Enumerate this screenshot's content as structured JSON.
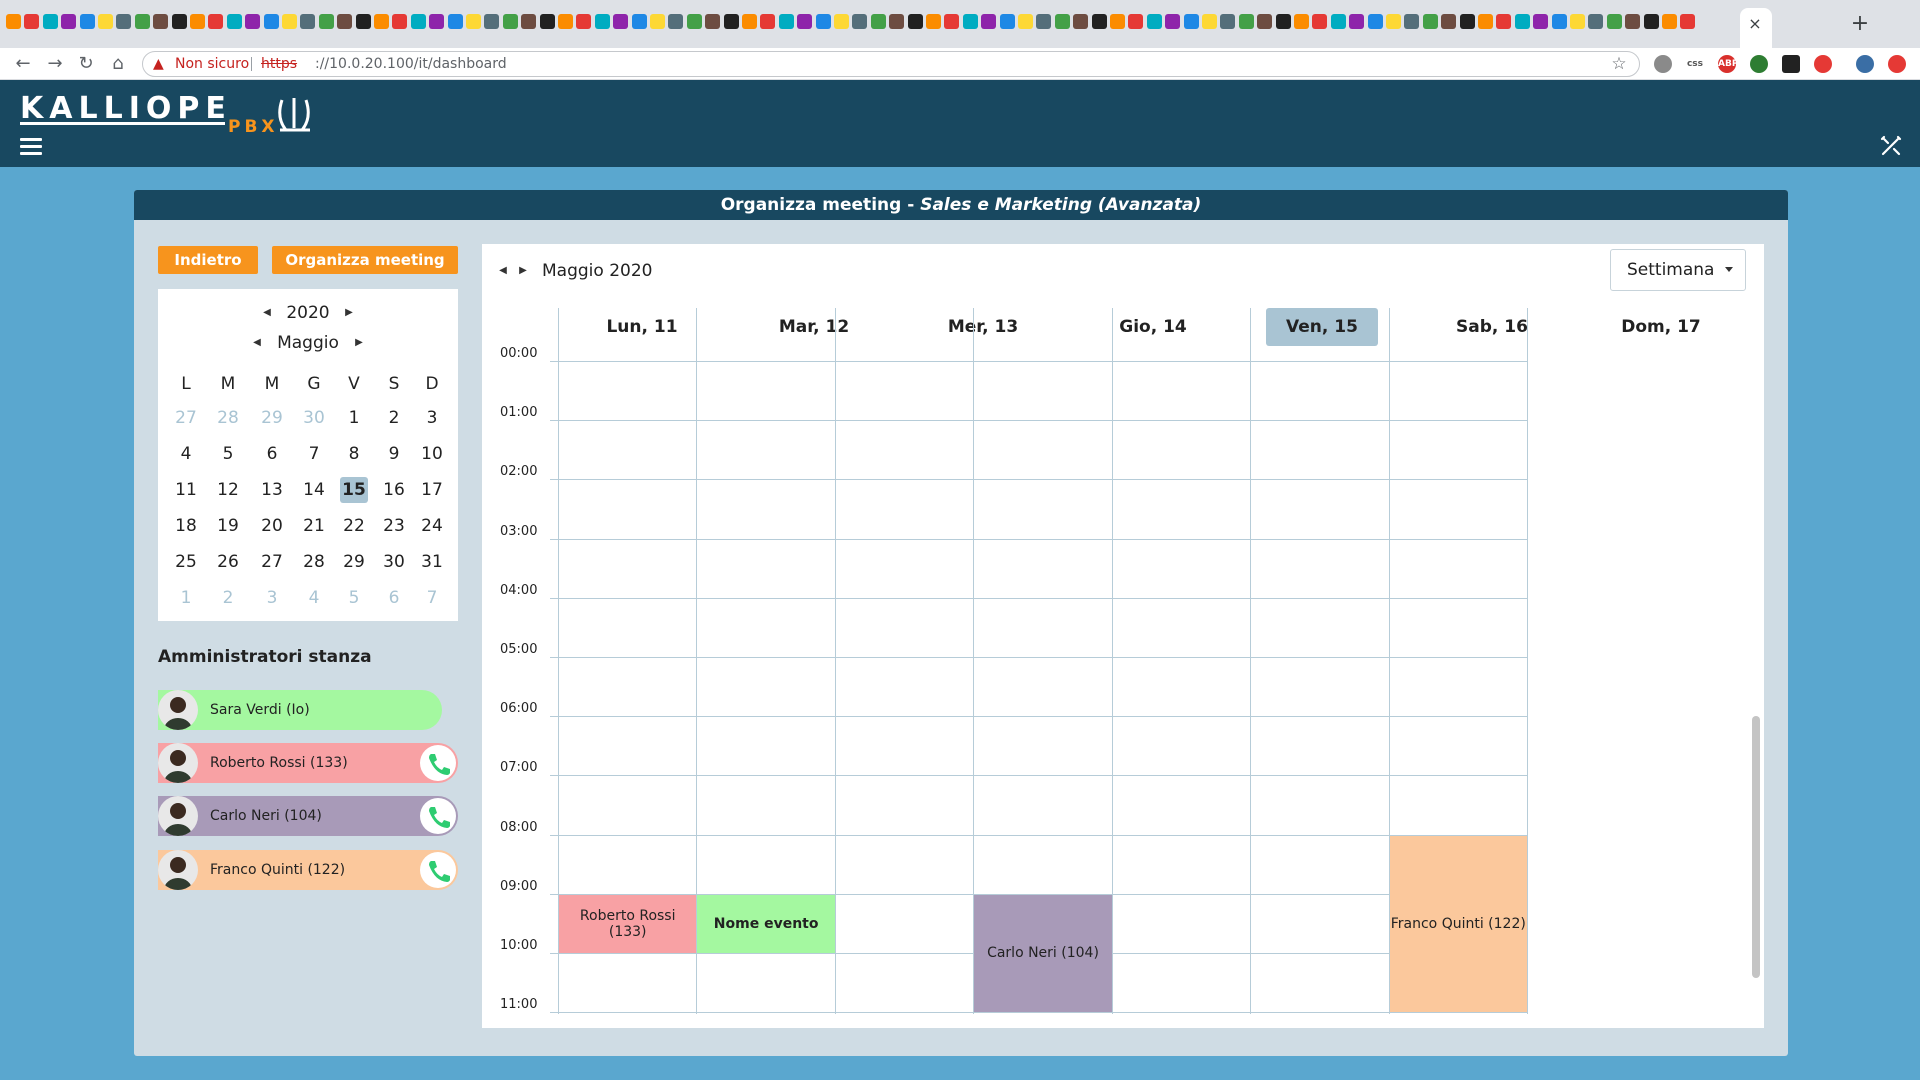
{
  "browser": {
    "not_secure": "Non sicuro",
    "url_scheme": "https",
    "url_rest": "://10.0.20.100/it/dashboard",
    "tab_close": "×",
    "new_tab": "+"
  },
  "app": {
    "logo_text": "KALLIOPE",
    "logo_sub": "PBX"
  },
  "panel": {
    "title": "Organizza meeting",
    "title_sep": " - ",
    "room_name": "Sales e Marketing (Avanzata)"
  },
  "buttons": {
    "back": "Indietro",
    "schedule": "Organizza meeting"
  },
  "minical": {
    "year": "2020",
    "month": "Maggio",
    "weekdays": [
      "L",
      "M",
      "M",
      "G",
      "V",
      "S",
      "D"
    ],
    "weeks": [
      [
        {
          "d": "27",
          "o": true
        },
        {
          "d": "28",
          "o": true
        },
        {
          "d": "29",
          "o": true
        },
        {
          "d": "30",
          "o": true
        },
        {
          "d": "1"
        },
        {
          "d": "2"
        },
        {
          "d": "3"
        }
      ],
      [
        {
          "d": "4"
        },
        {
          "d": "5"
        },
        {
          "d": "6"
        },
        {
          "d": "7"
        },
        {
          "d": "8"
        },
        {
          "d": "9"
        },
        {
          "d": "10"
        }
      ],
      [
        {
          "d": "11"
        },
        {
          "d": "12"
        },
        {
          "d": "13"
        },
        {
          "d": "14"
        },
        {
          "d": "15",
          "t": true
        },
        {
          "d": "16"
        },
        {
          "d": "17"
        }
      ],
      [
        {
          "d": "18"
        },
        {
          "d": "19"
        },
        {
          "d": "20"
        },
        {
          "d": "21"
        },
        {
          "d": "22"
        },
        {
          "d": "23"
        },
        {
          "d": "24"
        }
      ],
      [
        {
          "d": "25"
        },
        {
          "d": "26"
        },
        {
          "d": "27"
        },
        {
          "d": "28"
        },
        {
          "d": "29"
        },
        {
          "d": "30"
        },
        {
          "d": "31"
        }
      ],
      [
        {
          "d": "1",
          "o": true
        },
        {
          "d": "2",
          "o": true
        },
        {
          "d": "3",
          "o": true
        },
        {
          "d": "4",
          "o": true
        },
        {
          "d": "5",
          "o": true
        },
        {
          "d": "6",
          "o": true
        },
        {
          "d": "7",
          "o": true
        }
      ]
    ]
  },
  "admins": {
    "title": "Amministratori stanza",
    "list": [
      {
        "name": "Sara Verdi (Io)",
        "color": "#a4f8a0",
        "call": false
      },
      {
        "name": "Roberto Rossi (133)",
        "color": "#f8a1a4",
        "call": true
      },
      {
        "name": "Carlo Neri (104)",
        "color": "#a89ab8",
        "call": true
      },
      {
        "name": "Franco Quinti (122)",
        "color": "#fbc89c",
        "call": true
      }
    ]
  },
  "calendar": {
    "month_label": "Maggio 2020",
    "view": "Settimana",
    "days": [
      {
        "label": "Lun, 11"
      },
      {
        "label": "Mar, 12"
      },
      {
        "label": "Mer, 13"
      },
      {
        "label": "Gio, 14"
      },
      {
        "label": "Ven, 15",
        "today": true
      },
      {
        "label": "Sab, 16"
      },
      {
        "label": "Dom, 17"
      }
    ],
    "hours": [
      "00:00",
      "01:00",
      "02:00",
      "03:00",
      "04:00",
      "05:00",
      "06:00",
      "07:00",
      "08:00",
      "09:00",
      "10:00",
      "11:00"
    ],
    "events": [
      {
        "label": "Roberto Rossi (133)",
        "day": 0,
        "start": 9,
        "end": 10,
        "color": "#f8a1a4",
        "bold": false
      },
      {
        "label": "Nome evento",
        "day": 1,
        "start": 9,
        "end": 10,
        "color": "#a4f8a0",
        "bold": true
      },
      {
        "label": "Carlo Neri (104)",
        "day": 3,
        "start": 9,
        "end": 11,
        "color": "#a89ab8",
        "bold": false
      },
      {
        "label": "Franco Quinti (122)",
        "day": 6,
        "start": 8,
        "end": 11,
        "color": "#fbc89c",
        "bold": false
      }
    ]
  },
  "colors": {
    "header": "#184860",
    "accent": "#f7941d",
    "today": "#a9c4d3"
  }
}
